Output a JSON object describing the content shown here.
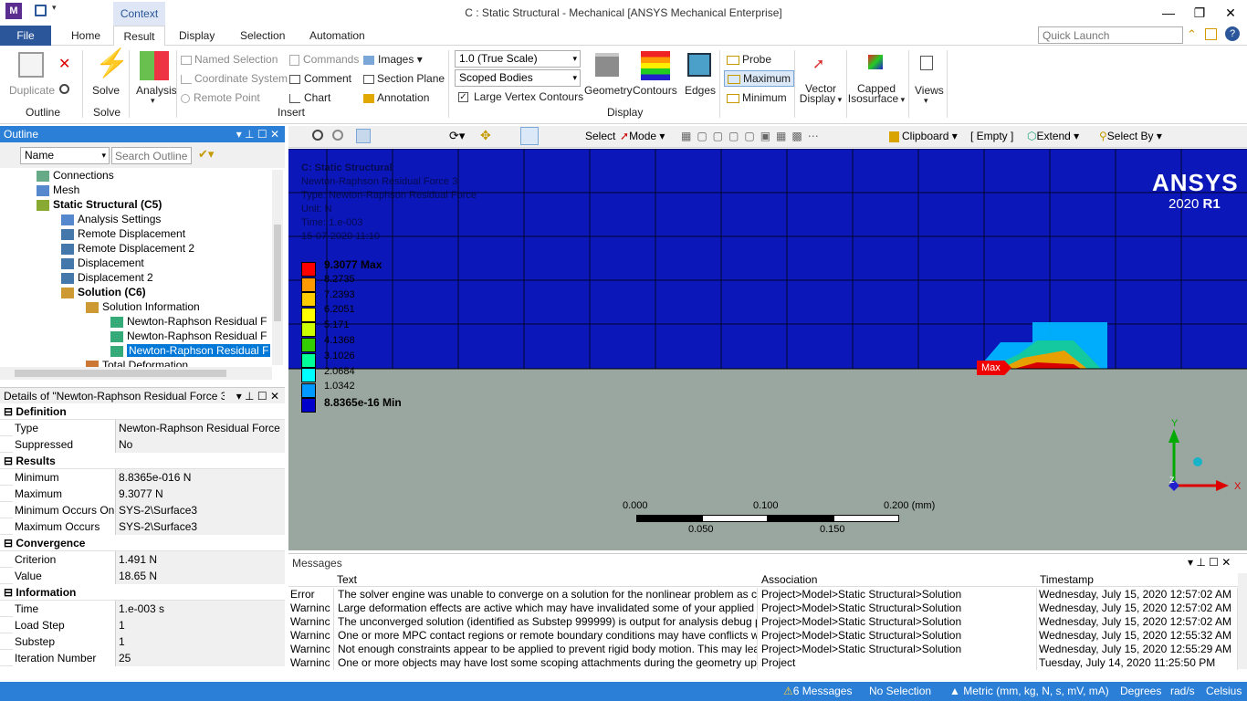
{
  "window": {
    "title": "C : Static Structural - Mechanical [ANSYS Mechanical Enterprise]",
    "context_tab": "Context",
    "app_badge": "M"
  },
  "ribbon_tabs": [
    "File",
    "Home",
    "Result",
    "Display",
    "Selection",
    "Automation"
  ],
  "quick_launch_placeholder": "Quick Launch",
  "ribbon": {
    "outline": {
      "duplicate": "Duplicate",
      "group": "Outline"
    },
    "solve": {
      "label": "Solve",
      "group": "Solve"
    },
    "analysis": {
      "label": "Analysis"
    },
    "insert": {
      "named_selection": "Named Selection",
      "coordinate_system": "Coordinate System",
      "remote_point": "Remote Point",
      "commands": "Commands",
      "comment": "Comment",
      "chart": "Chart",
      "images": "Images",
      "section_plane": "Section Plane",
      "annotation": "Annotation",
      "group": "Insert"
    },
    "display": {
      "scale_value": "1.0 (True Scale)",
      "bodies_value": "Scoped Bodies",
      "large_vertex_contours": "Large Vertex Contours",
      "geometry": "Geometry",
      "contours": "Contours",
      "edges": "Edges",
      "group": "Display"
    },
    "probe": "Probe",
    "maximum": "Maximum",
    "minimum": "Minimum",
    "vector_display": [
      "Vector",
      "Display"
    ],
    "capped_isosurface": [
      "Capped",
      "Isosurface"
    ],
    "views": "Views"
  },
  "graphics_toolbar": {
    "select": "Select",
    "mode": "Mode",
    "clipboard": "Clipboard",
    "empty": "[ Empty ]",
    "extend": "Extend",
    "select_by": "Select By"
  },
  "outline": {
    "title": "Outline",
    "filter_name": "Name",
    "search_placeholder": "Search Outline",
    "items": [
      {
        "label": "Connections",
        "indent": 1,
        "bold": false
      },
      {
        "label": "Mesh",
        "indent": 1,
        "bold": false
      },
      {
        "label": "Static Structural (C5)",
        "indent": 1,
        "bold": true
      },
      {
        "label": "Analysis Settings",
        "indent": 2,
        "bold": false
      },
      {
        "label": "Remote Displacement",
        "indent": 2,
        "bold": false
      },
      {
        "label": "Remote Displacement 2",
        "indent": 2,
        "bold": false
      },
      {
        "label": "Displacement",
        "indent": 2,
        "bold": false
      },
      {
        "label": "Displacement 2",
        "indent": 2,
        "bold": false
      },
      {
        "label": "Solution (C6)",
        "indent": 2,
        "bold": true
      },
      {
        "label": "Solution Information",
        "indent": 3,
        "bold": false
      },
      {
        "label": "Newton-Raphson Residual F",
        "indent": 4,
        "bold": false
      },
      {
        "label": "Newton-Raphson Residual F",
        "indent": 4,
        "bold": false
      },
      {
        "label": "Newton-Raphson Residual F",
        "indent": 4,
        "bold": false,
        "selected": true
      },
      {
        "label": "Total Deformation",
        "indent": 3,
        "bold": false
      }
    ]
  },
  "details": {
    "title": "Details of \"Newton-Raphson Residual Force 3\"",
    "rows": [
      {
        "section": "Definition"
      },
      {
        "key": "Type",
        "value": "Newton-Raphson Residual Force"
      },
      {
        "key": "Suppressed",
        "value": "No"
      },
      {
        "section": "Results"
      },
      {
        "key": "Minimum",
        "value": "8.8365e-016 N"
      },
      {
        "key": "Maximum",
        "value": "9.3077 N"
      },
      {
        "key": "Minimum Occurs On",
        "value": "SYS-2\\Surface3"
      },
      {
        "key": "Maximum Occurs On",
        "value": "SYS-2\\Surface3"
      },
      {
        "section": "Convergence"
      },
      {
        "key": "Criterion",
        "value": "1.491 N"
      },
      {
        "key": "Value",
        "value": "18.65 N"
      },
      {
        "section": "Information"
      },
      {
        "key": "Time",
        "value": "1.e-003 s"
      },
      {
        "key": "Load Step",
        "value": "1"
      },
      {
        "key": "Substep",
        "value": "1"
      },
      {
        "key": "Iteration Number",
        "value": "25"
      }
    ]
  },
  "viewport": {
    "header": [
      "C: Static Structural",
      "Newton-Raphson Residual Force 3",
      "Type: Newton-Raphson Residual Force",
      "Unit: N",
      "Time: 1.e-003",
      "15-07-2020 11:10"
    ],
    "legend": [
      "9.3077 Max",
      "8.2735",
      "7.2393",
      "6.2051",
      "5.171",
      "4.1368",
      "3.1026",
      "2.0684",
      "1.0342",
      "8.8365e-16 Min"
    ],
    "legend_colors": [
      "#ff0000",
      "#ff9900",
      "#ffcc00",
      "#ffff00",
      "#ccff00",
      "#33cc00",
      "#00ff99",
      "#00ffff",
      "#0099ff",
      "#0000cc"
    ],
    "brand": "ANSYS",
    "version_prefix": "2020 ",
    "version_release": "R1",
    "max_tag": "Max",
    "scale": {
      "top_labels": [
        "0.000",
        "0.100",
        "0.200 (mm)"
      ],
      "bottom_labels": [
        "0.050",
        "0.150"
      ]
    },
    "axes": {
      "y": "Y",
      "x": "X",
      "z": "Z"
    }
  },
  "messages": {
    "title": "Messages",
    "columns": [
      "Text",
      "Association",
      "Timestamp"
    ],
    "rows": [
      {
        "type": "Error",
        "text": "The solver engine was unable to converge on a solution for the nonlinear problem as cor",
        "assoc": "Project>Model>Static Structural>Solution",
        "time": "Wednesday, July 15, 2020 12:57:02 AM"
      },
      {
        "type": "Warninc",
        "text": "Large deformation effects are active which may have invalidated some of your applied sup",
        "assoc": "Project>Model>Static Structural>Solution",
        "time": "Wednesday, July 15, 2020 12:57:02 AM"
      },
      {
        "type": "Warninc",
        "text": "The unconverged solution (identified as Substep 999999) is output for analysis debug pu",
        "assoc": "Project>Model>Static Structural>Solution",
        "time": "Wednesday, July 15, 2020 12:57:02 AM"
      },
      {
        "type": "Warninc",
        "text": "One or more MPC contact regions or remote boundary conditions may have conflicts with",
        "assoc": "Project>Model>Static Structural>Solution",
        "time": "Wednesday, July 15, 2020 12:55:32 AM"
      },
      {
        "type": "Warninc",
        "text": "Not enough constraints appear to be applied to prevent rigid body motion.  This may lea",
        "assoc": "Project>Model>Static Structural>Solution",
        "time": "Wednesday, July 15, 2020 12:55:29 AM"
      },
      {
        "type": "Warninc",
        "text": "One or more objects may have lost some scoping attachments during the geometry updat",
        "assoc": "Project",
        "time": "Tuesday, July 14, 2020 11:25:50 PM"
      }
    ]
  },
  "status": {
    "messages": "6 Messages",
    "selection": "No Selection",
    "units": "Metric (mm, kg, N, s, mV, mA)",
    "angle": "Degrees",
    "rot": "rad/s",
    "temp": "Celsius"
  },
  "colors": {
    "accent": "#2b579a",
    "panel_header": "#2b7fd6",
    "viewport_bg": "#0b17b8",
    "ground": "#9aa7a0"
  }
}
